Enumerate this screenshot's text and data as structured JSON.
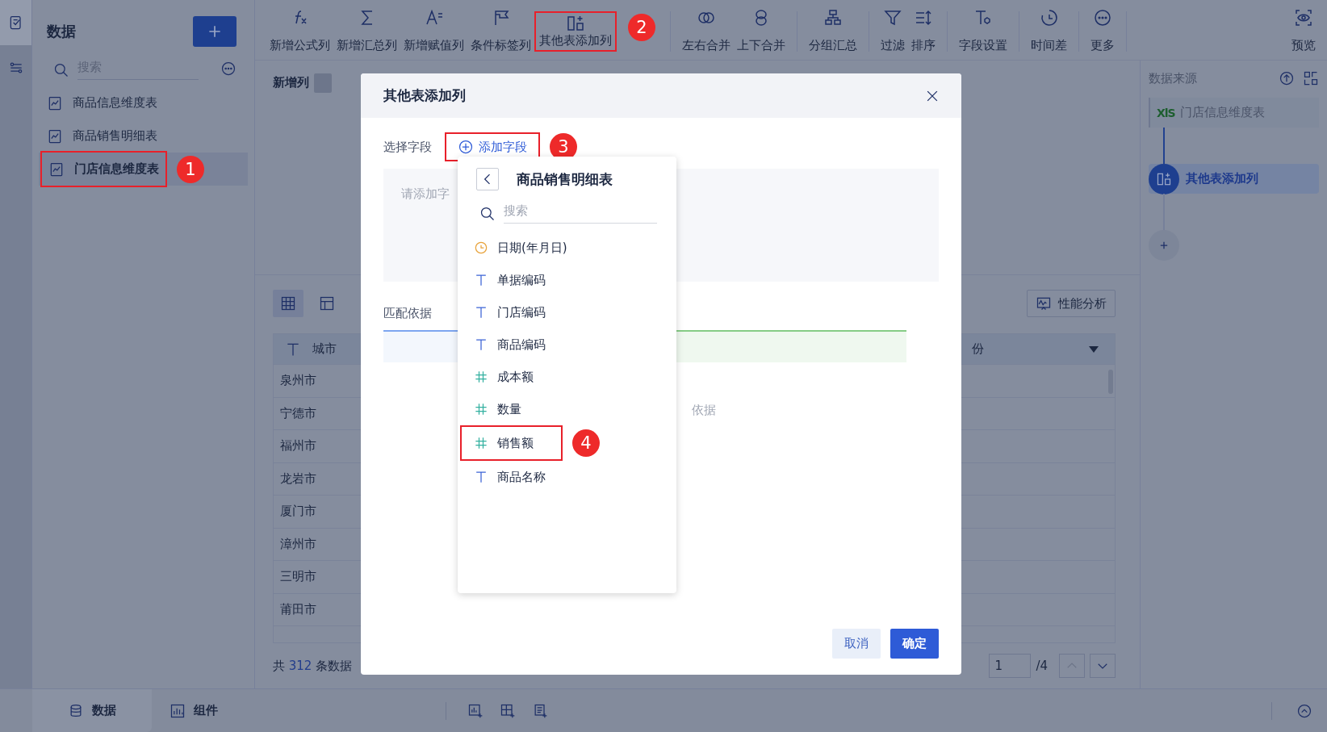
{
  "rail": {
    "items": [
      {
        "selected": true
      },
      {
        "selected": false
      }
    ]
  },
  "data_panel": {
    "title": "数据",
    "search": {
      "placeholder": "搜索"
    },
    "tables": [
      {
        "name": "商品信息维度表",
        "selected": false
      },
      {
        "name": "商品销售明细表",
        "selected": false
      },
      {
        "name": "门店信息维度表",
        "selected": true,
        "callout": "1"
      }
    ]
  },
  "toolbar": {
    "groups": [
      [
        {
          "label": "新增公式列"
        },
        {
          "label": "新增汇总列"
        },
        {
          "label": "新增赋值列"
        },
        {
          "label": "条件标签列"
        },
        {
          "label": "其他表添加列",
          "callout": "2"
        }
      ],
      [
        {
          "label": "左右合并"
        },
        {
          "label": "上下合并"
        }
      ],
      [
        {
          "label": "分组汇总"
        }
      ],
      [
        {
          "label": "过滤"
        },
        {
          "label": "排序"
        }
      ],
      [
        {
          "label": "字段设置"
        }
      ],
      [
        {
          "label": "时间差"
        }
      ],
      [
        {
          "label": "更多"
        }
      ],
      [
        {
          "label": "预览"
        }
      ]
    ]
  },
  "editor": {
    "title": "新增列"
  },
  "data_view": {
    "view_toggles": [
      {
        "selected": true
      },
      {
        "selected": false
      }
    ],
    "perf_button": "性能分析",
    "columns": [
      {
        "name": "城市",
        "kind": "text"
      },
      {
        "name": "份",
        "kind": "sortable"
      }
    ],
    "rows": [
      "泉州市",
      "宁德市",
      "福州市",
      "龙岩市",
      "厦门市",
      "漳州市",
      "三明市",
      "莆田市"
    ],
    "total": {
      "prefix": "共",
      "count": "312",
      "suffix": "条数据"
    },
    "pager": {
      "page": "1",
      "pages": "/4"
    }
  },
  "source_panel": {
    "title": "数据来源",
    "source": {
      "badge": "XlS",
      "name": "门店信息维度表"
    },
    "steps": [
      {
        "label": "其他表添加列",
        "selected": true
      }
    ]
  },
  "bottom_bar": {
    "tabs": [
      {
        "label": "数据",
        "selected": true
      },
      {
        "label": "组件",
        "selected": false
      }
    ]
  },
  "dialog": {
    "title": "其他表添加列",
    "field_label": "选择字段",
    "add_button": {
      "label": "添加字段",
      "callout": "3"
    },
    "field_hint": "请添加字",
    "match_label": "匹配依据",
    "match_hint": "依据",
    "buttons": [
      {
        "label": "取消",
        "kind": "secondary"
      },
      {
        "label": "确定",
        "kind": "primary"
      }
    ]
  },
  "field_picker": {
    "title": "商品销售明细表",
    "search": {
      "placeholder": "搜索"
    },
    "fields": [
      {
        "name": "日期(年月日)",
        "kind": "date"
      },
      {
        "name": "单据编码",
        "kind": "text"
      },
      {
        "name": "门店编码",
        "kind": "text"
      },
      {
        "name": "商品编码",
        "kind": "text"
      },
      {
        "name": "成本额",
        "kind": "number"
      },
      {
        "name": "数量",
        "kind": "number"
      },
      {
        "name": "销售额",
        "kind": "number",
        "callout": "4"
      },
      {
        "name": "商品名称",
        "kind": "text"
      }
    ]
  }
}
